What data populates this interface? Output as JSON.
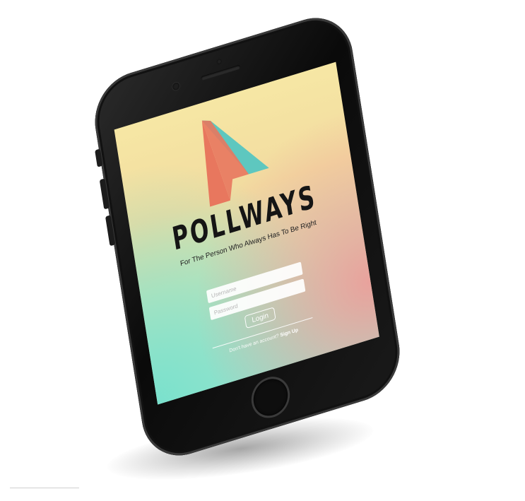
{
  "app": {
    "brand_name": "POLLWAYS",
    "tagline": "For The Person Who Always Has To Be Right"
  },
  "login_form": {
    "username_placeholder": "Username",
    "password_placeholder": "Password",
    "login_label": "Login"
  },
  "footer": {
    "signup_prompt": "Don't have an account?",
    "signup_link": "Sign Up"
  },
  "icons": {
    "logo": "pollways-a-logo-icon"
  },
  "colors": {
    "logo_coral": "#e8775e",
    "logo_teal": "#5ec7bf",
    "text_dark": "#151515",
    "screen_top": "#f6e7a4",
    "screen_bottom_left": "#a9e4cb",
    "screen_bottom_right": "#f09a96"
  }
}
